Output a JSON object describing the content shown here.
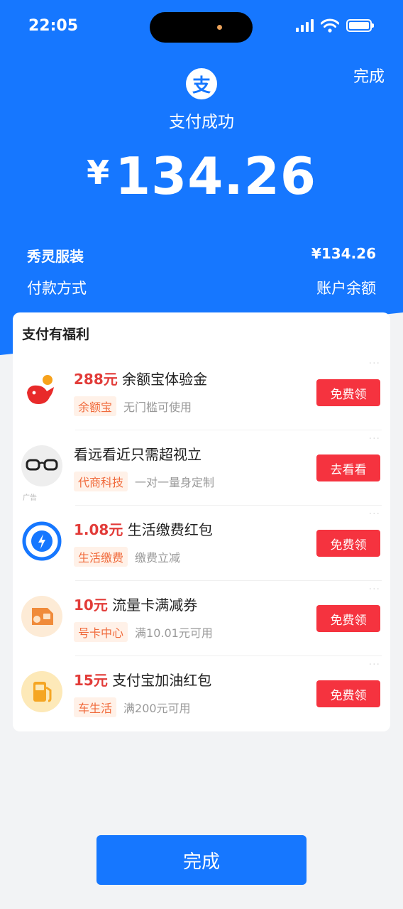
{
  "status": {
    "time": "22:05"
  },
  "header": {
    "done_label": "完成",
    "logo_glyph": "支",
    "title": "支付成功",
    "currency": "¥",
    "amount": "134.26"
  },
  "summary": {
    "merchant": "秀灵服装",
    "merchant_amount": "¥134.26",
    "method_label": "付款方式",
    "method_value": "账户余额"
  },
  "benefits": {
    "title": "支付有福利",
    "more": "···",
    "items": [
      {
        "highlight": "288元",
        "title": " 余额宝体验金",
        "tag": "余额宝",
        "desc": "无门槛可使用",
        "button": "免费领",
        "icon": "yuebao-icon"
      },
      {
        "highlight": "",
        "title": "看远看近只需超视立",
        "tag": "代商科技",
        "desc": "一对一量身定制",
        "button": "去看看",
        "icon": "glasses-icon",
        "ad": "广告"
      },
      {
        "highlight": "1.08元",
        "title": " 生活缴费红包",
        "tag": "生活缴费",
        "desc": "缴费立减",
        "button": "免费领",
        "icon": "lightning-icon"
      },
      {
        "highlight": "10元",
        "title": " 流量卡满减券",
        "tag": "号卡中心",
        "desc": "满10.01元可用",
        "button": "免费领",
        "icon": "sim-card-icon"
      },
      {
        "highlight": "15元",
        "title": " 支付宝加油红包",
        "tag": "车生活",
        "desc": "满200元可用",
        "button": "免费领",
        "icon": "fuel-pump-icon"
      }
    ]
  },
  "footer": {
    "done_label": "完成"
  },
  "colors": {
    "primary": "#1677ff",
    "red": "#f5333f",
    "highlight": "#e23c39"
  }
}
